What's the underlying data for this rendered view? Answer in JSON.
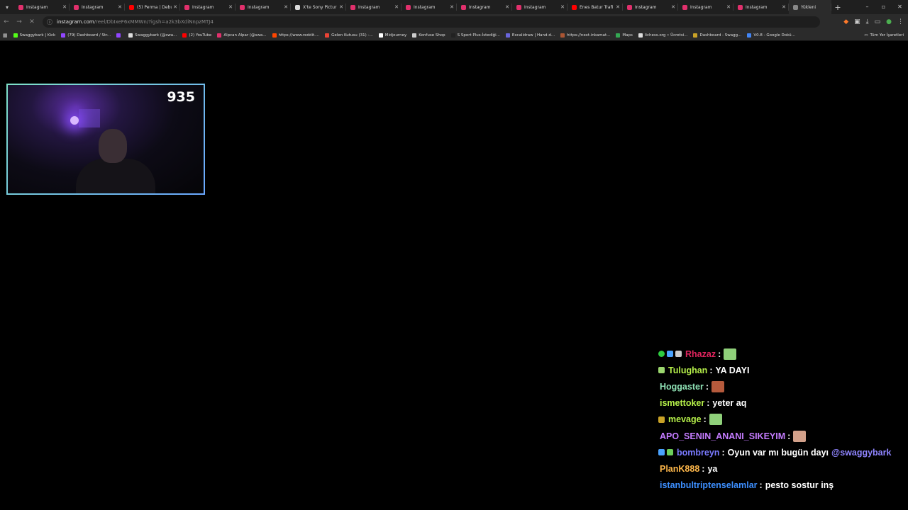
{
  "browser": {
    "tabs": [
      {
        "label": "Instagram",
        "favicon": "instagram-icon",
        "color": "#e1306c"
      },
      {
        "label": "Instagram",
        "favicon": "instagram-icon",
        "color": "#e1306c"
      },
      {
        "label": "(5) Perma | Debu",
        "favicon": "youtube-icon",
        "color": "#ff0000"
      },
      {
        "label": "Instagram",
        "favicon": "instagram-icon",
        "color": "#e1306c"
      },
      {
        "label": "Instagram",
        "favicon": "instagram-icon",
        "color": "#e1306c"
      },
      {
        "label": "X'te Sony Pictur",
        "favicon": "x-icon",
        "color": "#dddddd"
      },
      {
        "label": "Instagram",
        "favicon": "instagram-icon",
        "color": "#e1306c"
      },
      {
        "label": "Instagram",
        "favicon": "instagram-icon",
        "color": "#e1306c"
      },
      {
        "label": "Instagram",
        "favicon": "instagram-icon",
        "color": "#e1306c"
      },
      {
        "label": "Instagram",
        "favicon": "instagram-icon",
        "color": "#e1306c"
      },
      {
        "label": "Enes Batur Trafi",
        "favicon": "youtube-icon",
        "color": "#ff0000"
      },
      {
        "label": "Instagram",
        "favicon": "instagram-icon",
        "color": "#e1306c"
      },
      {
        "label": "Instagram",
        "favicon": "instagram-icon",
        "color": "#e1306c"
      },
      {
        "label": "Instagram",
        "favicon": "instagram-icon",
        "color": "#e1306c"
      },
      {
        "label": "Yükleni",
        "favicon": "loading-icon",
        "color": "#888888",
        "active": true
      }
    ],
    "new_tab": "+",
    "address": {
      "host": "instagram.com",
      "path": "/reel/DbIxeF6xMMWn/?igsh=a2k3bXdiNnpzMTJ4"
    },
    "bookmarks": [
      {
        "label": "Swaggybark | Kick",
        "color": "#53fc18"
      },
      {
        "label": "(79) Dashboard / Str...",
        "color": "#9146ff"
      },
      {
        "label": "",
        "color": "#9146ff"
      },
      {
        "label": "Swaggybark (@swa...",
        "color": "#dddddd"
      },
      {
        "label": "(2) YouTube",
        "color": "#ff0000"
      },
      {
        "label": "Alpcan Alpar (@swa...",
        "color": "#e1306c"
      },
      {
        "label": "https://www.reddit....",
        "color": "#ff4500"
      },
      {
        "label": "Gelen Kutusu (31) -...",
        "color": "#ea4335"
      },
      {
        "label": "Midjourney",
        "color": "#ffffff"
      },
      {
        "label": "Konfuse Shop",
        "color": "#cccccc"
      },
      {
        "label": "S Sport Plus-İstediği...",
        "color": "#222222"
      },
      {
        "label": "Excalidraw | Hand-d...",
        "color": "#6965db"
      },
      {
        "label": "https://next.inkamat...",
        "color": "#aa5533"
      },
      {
        "label": "Maps",
        "color": "#34a853"
      },
      {
        "label": "lichess.org • Ücretsi...",
        "color": "#dddddd"
      },
      {
        "label": "Dashboard - Swagg...",
        "color": "#c9a227"
      },
      {
        "label": "V0.8 - Google Dokü...",
        "color": "#4285f4"
      }
    ],
    "all_bookmarks": "Tüm Yer İşaretleri"
  },
  "stream": {
    "viewer_count": "935"
  },
  "chat": [
    {
      "badges": [
        "#2ecc40",
        "#4aa3ff",
        "#cccccc"
      ],
      "user": "Rhazaz",
      "user_color": "#e0245e",
      "text": "",
      "emote": "#8fd07a"
    },
    {
      "badges": [
        "#9bd66e"
      ],
      "user": "Tulughan",
      "user_color": "#b6f04a",
      "text": "YA DAYI",
      "emote": null
    },
    {
      "badges": [],
      "user": "Hoggaster",
      "user_color": "#8ee0b4",
      "text": "",
      "emote": "#b55a3c"
    },
    {
      "badges": [],
      "user": "ismettoker",
      "user_color": "#b6f04a",
      "text": "yeter aq",
      "emote": null
    },
    {
      "badges": [
        "#c9a227"
      ],
      "user": "mevage",
      "user_color": "#b6f04a",
      "text": "",
      "emote": "#8fd07a"
    },
    {
      "badges": [],
      "user": "APO_SENIN_ANANI_SIKEYIM",
      "user_color": "#c57cff",
      "text": "",
      "emote": "#d2a08a"
    },
    {
      "badges": [
        "#4aa3ff",
        "#6ccf5a"
      ],
      "user": "bombreyn",
      "user_color": "#7a7aff",
      "text": "Oyun var mı bugün dayı",
      "mention": "@swaggybark",
      "emote": null
    },
    {
      "badges": [],
      "user": "PlanK888",
      "user_color": "#ffb84a",
      "text": "ya",
      "emote": null
    },
    {
      "badges": [],
      "user": "istanbultriptenselamlar",
      "user_color": "#3d8fff",
      "text": "pesto sostur inş",
      "emote": null
    }
  ]
}
